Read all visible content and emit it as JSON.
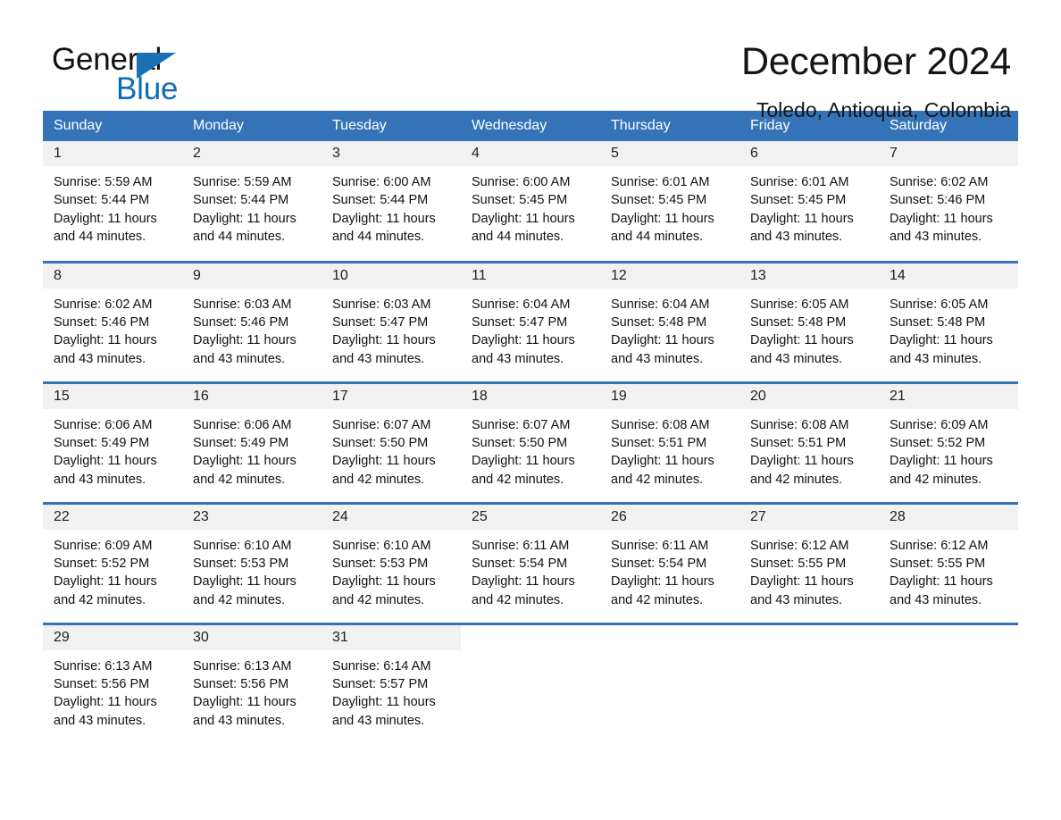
{
  "brand": {
    "name_part1": "General",
    "name_part2": "Blue",
    "flag_icon": "blue-triangle-flag-icon",
    "accent_color": "#0b6fb8"
  },
  "header": {
    "title": "December 2024",
    "location": "Toledo, Antioquia, Colombia"
  },
  "theme": {
    "header_blue": "#3573b9",
    "day_band_gray": "#f1f1f1",
    "text_black": "#111111"
  },
  "calendar": {
    "weekday_headers": [
      "Sunday",
      "Monday",
      "Tuesday",
      "Wednesday",
      "Thursday",
      "Friday",
      "Saturday"
    ],
    "weeks": [
      [
        {
          "day": "1",
          "sunrise": "Sunrise: 5:59 AM",
          "sunset": "Sunset: 5:44 PM",
          "daylight": "Daylight: 11 hours and 44 minutes."
        },
        {
          "day": "2",
          "sunrise": "Sunrise: 5:59 AM",
          "sunset": "Sunset: 5:44 PM",
          "daylight": "Daylight: 11 hours and 44 minutes."
        },
        {
          "day": "3",
          "sunrise": "Sunrise: 6:00 AM",
          "sunset": "Sunset: 5:44 PM",
          "daylight": "Daylight: 11 hours and 44 minutes."
        },
        {
          "day": "4",
          "sunrise": "Sunrise: 6:00 AM",
          "sunset": "Sunset: 5:45 PM",
          "daylight": "Daylight: 11 hours and 44 minutes."
        },
        {
          "day": "5",
          "sunrise": "Sunrise: 6:01 AM",
          "sunset": "Sunset: 5:45 PM",
          "daylight": "Daylight: 11 hours and 44 minutes."
        },
        {
          "day": "6",
          "sunrise": "Sunrise: 6:01 AM",
          "sunset": "Sunset: 5:45 PM",
          "daylight": "Daylight: 11 hours and 43 minutes."
        },
        {
          "day": "7",
          "sunrise": "Sunrise: 6:02 AM",
          "sunset": "Sunset: 5:46 PM",
          "daylight": "Daylight: 11 hours and 43 minutes."
        }
      ],
      [
        {
          "day": "8",
          "sunrise": "Sunrise: 6:02 AM",
          "sunset": "Sunset: 5:46 PM",
          "daylight": "Daylight: 11 hours and 43 minutes."
        },
        {
          "day": "9",
          "sunrise": "Sunrise: 6:03 AM",
          "sunset": "Sunset: 5:46 PM",
          "daylight": "Daylight: 11 hours and 43 minutes."
        },
        {
          "day": "10",
          "sunrise": "Sunrise: 6:03 AM",
          "sunset": "Sunset: 5:47 PM",
          "daylight": "Daylight: 11 hours and 43 minutes."
        },
        {
          "day": "11",
          "sunrise": "Sunrise: 6:04 AM",
          "sunset": "Sunset: 5:47 PM",
          "daylight": "Daylight: 11 hours and 43 minutes."
        },
        {
          "day": "12",
          "sunrise": "Sunrise: 6:04 AM",
          "sunset": "Sunset: 5:48 PM",
          "daylight": "Daylight: 11 hours and 43 minutes."
        },
        {
          "day": "13",
          "sunrise": "Sunrise: 6:05 AM",
          "sunset": "Sunset: 5:48 PM",
          "daylight": "Daylight: 11 hours and 43 minutes."
        },
        {
          "day": "14",
          "sunrise": "Sunrise: 6:05 AM",
          "sunset": "Sunset: 5:48 PM",
          "daylight": "Daylight: 11 hours and 43 minutes."
        }
      ],
      [
        {
          "day": "15",
          "sunrise": "Sunrise: 6:06 AM",
          "sunset": "Sunset: 5:49 PM",
          "daylight": "Daylight: 11 hours and 43 minutes."
        },
        {
          "day": "16",
          "sunrise": "Sunrise: 6:06 AM",
          "sunset": "Sunset: 5:49 PM",
          "daylight": "Daylight: 11 hours and 42 minutes."
        },
        {
          "day": "17",
          "sunrise": "Sunrise: 6:07 AM",
          "sunset": "Sunset: 5:50 PM",
          "daylight": "Daylight: 11 hours and 42 minutes."
        },
        {
          "day": "18",
          "sunrise": "Sunrise: 6:07 AM",
          "sunset": "Sunset: 5:50 PM",
          "daylight": "Daylight: 11 hours and 42 minutes."
        },
        {
          "day": "19",
          "sunrise": "Sunrise: 6:08 AM",
          "sunset": "Sunset: 5:51 PM",
          "daylight": "Daylight: 11 hours and 42 minutes."
        },
        {
          "day": "20",
          "sunrise": "Sunrise: 6:08 AM",
          "sunset": "Sunset: 5:51 PM",
          "daylight": "Daylight: 11 hours and 42 minutes."
        },
        {
          "day": "21",
          "sunrise": "Sunrise: 6:09 AM",
          "sunset": "Sunset: 5:52 PM",
          "daylight": "Daylight: 11 hours and 42 minutes."
        }
      ],
      [
        {
          "day": "22",
          "sunrise": "Sunrise: 6:09 AM",
          "sunset": "Sunset: 5:52 PM",
          "daylight": "Daylight: 11 hours and 42 minutes."
        },
        {
          "day": "23",
          "sunrise": "Sunrise: 6:10 AM",
          "sunset": "Sunset: 5:53 PM",
          "daylight": "Daylight: 11 hours and 42 minutes."
        },
        {
          "day": "24",
          "sunrise": "Sunrise: 6:10 AM",
          "sunset": "Sunset: 5:53 PM",
          "daylight": "Daylight: 11 hours and 42 minutes."
        },
        {
          "day": "25",
          "sunrise": "Sunrise: 6:11 AM",
          "sunset": "Sunset: 5:54 PM",
          "daylight": "Daylight: 11 hours and 42 minutes."
        },
        {
          "day": "26",
          "sunrise": "Sunrise: 6:11 AM",
          "sunset": "Sunset: 5:54 PM",
          "daylight": "Daylight: 11 hours and 42 minutes."
        },
        {
          "day": "27",
          "sunrise": "Sunrise: 6:12 AM",
          "sunset": "Sunset: 5:55 PM",
          "daylight": "Daylight: 11 hours and 43 minutes."
        },
        {
          "day": "28",
          "sunrise": "Sunrise: 6:12 AM",
          "sunset": "Sunset: 5:55 PM",
          "daylight": "Daylight: 11 hours and 43 minutes."
        }
      ],
      [
        {
          "day": "29",
          "sunrise": "Sunrise: 6:13 AM",
          "sunset": "Sunset: 5:56 PM",
          "daylight": "Daylight: 11 hours and 43 minutes."
        },
        {
          "day": "30",
          "sunrise": "Sunrise: 6:13 AM",
          "sunset": "Sunset: 5:56 PM",
          "daylight": "Daylight: 11 hours and 43 minutes."
        },
        {
          "day": "31",
          "sunrise": "Sunrise: 6:14 AM",
          "sunset": "Sunset: 5:57 PM",
          "daylight": "Daylight: 11 hours and 43 minutes."
        },
        {
          "day": "",
          "sunrise": "",
          "sunset": "",
          "daylight": ""
        },
        {
          "day": "",
          "sunrise": "",
          "sunset": "",
          "daylight": ""
        },
        {
          "day": "",
          "sunrise": "",
          "sunset": "",
          "daylight": ""
        },
        {
          "day": "",
          "sunrise": "",
          "sunset": "",
          "daylight": ""
        }
      ]
    ]
  }
}
